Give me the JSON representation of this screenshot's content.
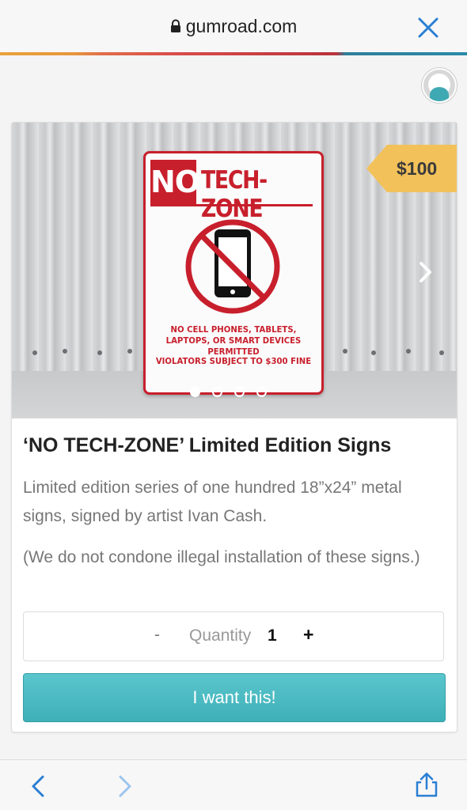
{
  "browser": {
    "url": "gumroad.com",
    "stripe_colors": [
      "#e8a23a",
      "#d84c4b",
      "#b8333b",
      "#2b8aa8"
    ]
  },
  "product": {
    "image": {
      "sign_no": "NO",
      "sign_zone": "TECH-ZONE",
      "sign_warning": "NO CELL PHONES, TABLETS, LAPTOPS, OR SMART DEVICES PERMITTED",
      "sign_fine": "VIOLATORS SUBJECT TO $300 FINE",
      "slide_count": 4,
      "active_slide": 1
    },
    "price": "$100",
    "title": "‘NO TECH-ZONE’ Limited Edition Signs",
    "description": "Limited edition series of one hundred 18”x24” metal signs, signed by artist Ivan Cash.",
    "disclaimer": "(We do not condone illegal installation of these signs.)",
    "quantity": {
      "minus": "-",
      "label": "Quantity",
      "value": "1",
      "plus": "+"
    },
    "cta": "I want this!"
  },
  "colors": {
    "accent": "#3fb0b8",
    "price_tag": "#f2c15a",
    "sign_red": "#c81f2c",
    "nav_blue": "#2a7fd4"
  },
  "icons": {
    "lock": "lock-icon",
    "close": "close-icon",
    "avatar": "user-avatar",
    "next": "chevron-right-icon",
    "back": "chevron-left-icon",
    "forward": "chevron-right-icon",
    "share": "share-icon"
  }
}
